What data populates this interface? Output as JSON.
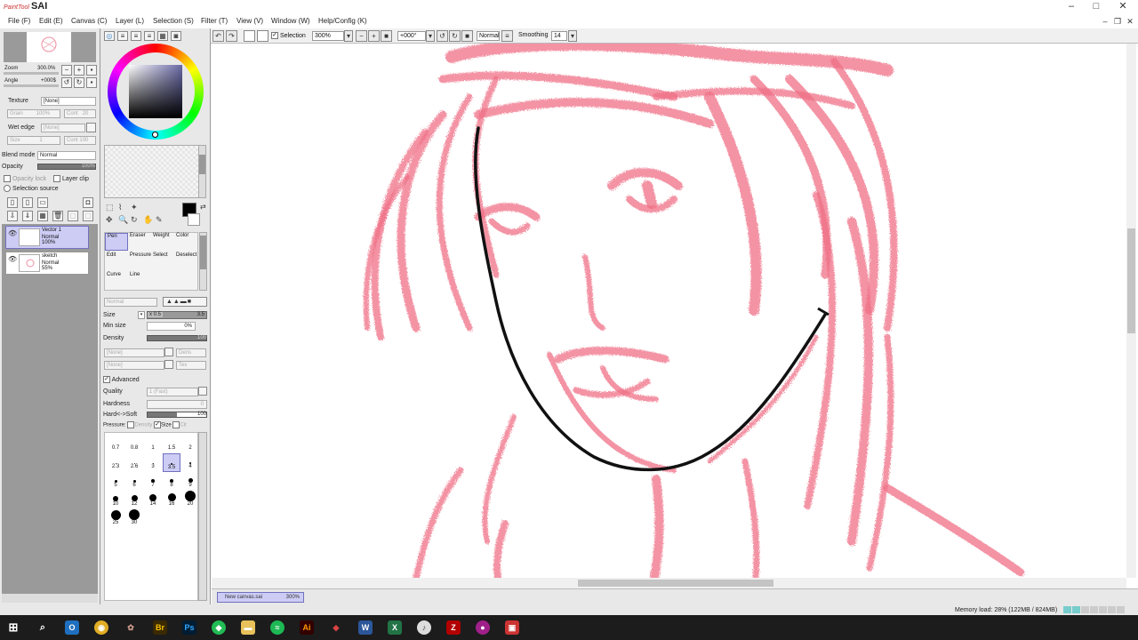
{
  "app": {
    "logo_small": "PaintTool",
    "logo_main": "SAI",
    "window_controls": [
      "–",
      "□",
      "✕"
    ]
  },
  "menu": [
    "File (F)",
    "Edit (E)",
    "Canvas (C)",
    "Layer (L)",
    "Selection (S)",
    "Filter (T)",
    "View (V)",
    "Window (W)",
    "Help/Config (K)"
  ],
  "navigator": {
    "zoom_label": "Zoom",
    "zoom_value": "300.0%",
    "angle_label": "Angle",
    "angle_value": "+000$"
  },
  "layer_props": {
    "texture_label": "Texture",
    "texture_value": "[None]",
    "grain_label": "Grain",
    "grain_value": "100%",
    "cont_label": "Cont",
    "cont_value": "20",
    "wet_edge_label": "Wet edge",
    "wet_edge_value": "[None]",
    "size_label": "Size",
    "size_value": "1",
    "cont2_value": "100",
    "blend_mode_label": "Blend mode",
    "blend_mode_value": "Normal",
    "opacity_label": "Opacity",
    "opacity_value": "100%",
    "opacity_lock": "Opacity lock",
    "layer_clip": "Layer clip",
    "selection_source": "Selection source"
  },
  "layers": [
    {
      "name": "Vector 1",
      "mode": "Normal",
      "opacity": "100%",
      "selected": true
    },
    {
      "name": "sketch",
      "mode": "Normal",
      "opacity": "55%",
      "selected": false
    }
  ],
  "tools": [
    {
      "label": "Pen",
      "selected": true
    },
    {
      "label": "Eraser",
      "selected": false
    },
    {
      "label": "Weight",
      "selected": false
    },
    {
      "label": "Color",
      "selected": false
    },
    {
      "label": "Edit",
      "selected": false
    },
    {
      "label": "Pressure",
      "selected": false
    },
    {
      "label": "Select",
      "selected": false
    },
    {
      "label": "Deselect",
      "selected": false
    },
    {
      "label": "Curve",
      "selected": false
    },
    {
      "label": "Line",
      "selected": false
    }
  ],
  "brush": {
    "mode_value": "Normal",
    "size_label": "Size",
    "size_mult": "x 0.5",
    "size_value": "3.5",
    "min_size_label": "Min size",
    "min_size_value": "0%",
    "density_label": "Density",
    "density_value": "100",
    "none1": "[None]",
    "none2": "[None]",
    "dens_label": "Dens",
    "tex_label": "Tex",
    "advanced_label": "Advanced",
    "quality_label": "Quality",
    "quality_value": "1 (Fast)",
    "hardness_label": "Hardness",
    "hardness_value": "0",
    "hard_soft_label": "Hard<->Soft",
    "hard_soft_value": "100",
    "pressure_label": "Pressure:",
    "pressure_density": "Density",
    "pressure_size": "Size",
    "pressure_clr": "Clr"
  },
  "brush_sizes": [
    {
      "label": "0.7",
      "dot": 0
    },
    {
      "label": "0.8",
      "dot": 0
    },
    {
      "label": "1",
      "dot": 0
    },
    {
      "label": "1.5",
      "dot": 0
    },
    {
      "label": "2",
      "dot": 0
    },
    {
      "label": "2.3",
      "dot": 1
    },
    {
      "label": "2.6",
      "dot": 1
    },
    {
      "label": "3",
      "dot": 1
    },
    {
      "label": "3.5",
      "dot": 2,
      "selected": true
    },
    {
      "label": "4",
      "dot": 2
    },
    {
      "label": "5",
      "dot": 3
    },
    {
      "label": "6",
      "dot": 3
    },
    {
      "label": "7",
      "dot": 4
    },
    {
      "label": "8",
      "dot": 4
    },
    {
      "label": "9",
      "dot": 5
    },
    {
      "label": "10",
      "dot": 6
    },
    {
      "label": "12",
      "dot": 7
    },
    {
      "label": "14",
      "dot": 8
    },
    {
      "label": "16",
      "dot": 9
    },
    {
      "label": "20",
      "dot": 12
    },
    {
      "label": "25",
      "dot": 11
    },
    {
      "label": "30",
      "dot": 12
    }
  ],
  "canvas_toolbar": {
    "selection_label": "Selection",
    "zoom_value": "300%",
    "angle_value": "+000°",
    "mode_value": "Normal",
    "smoothing_label": "Smoothing",
    "smoothing_value": "14"
  },
  "document_tab": {
    "name": "New canvas.sai",
    "zoom": "300%"
  },
  "status": {
    "memory": "Memory load: 28% (122MB / 824MB)"
  },
  "taskbar_icons": [
    "windows-start",
    "search",
    "outlook",
    "chrome",
    "gimp",
    "bridge",
    "photoshop",
    "sai",
    "file-explorer",
    "spotify",
    "illustrator",
    "git",
    "word",
    "excel",
    "itunes",
    "filezilla",
    "cinema",
    "paint-tool-sai"
  ],
  "colors": {
    "panel_bg": "#e8e8e8",
    "selection": "#ccccf5",
    "sketch_pink": "#ef6f86",
    "ink": "#111111",
    "taskbar": "#1c1c1c"
  }
}
